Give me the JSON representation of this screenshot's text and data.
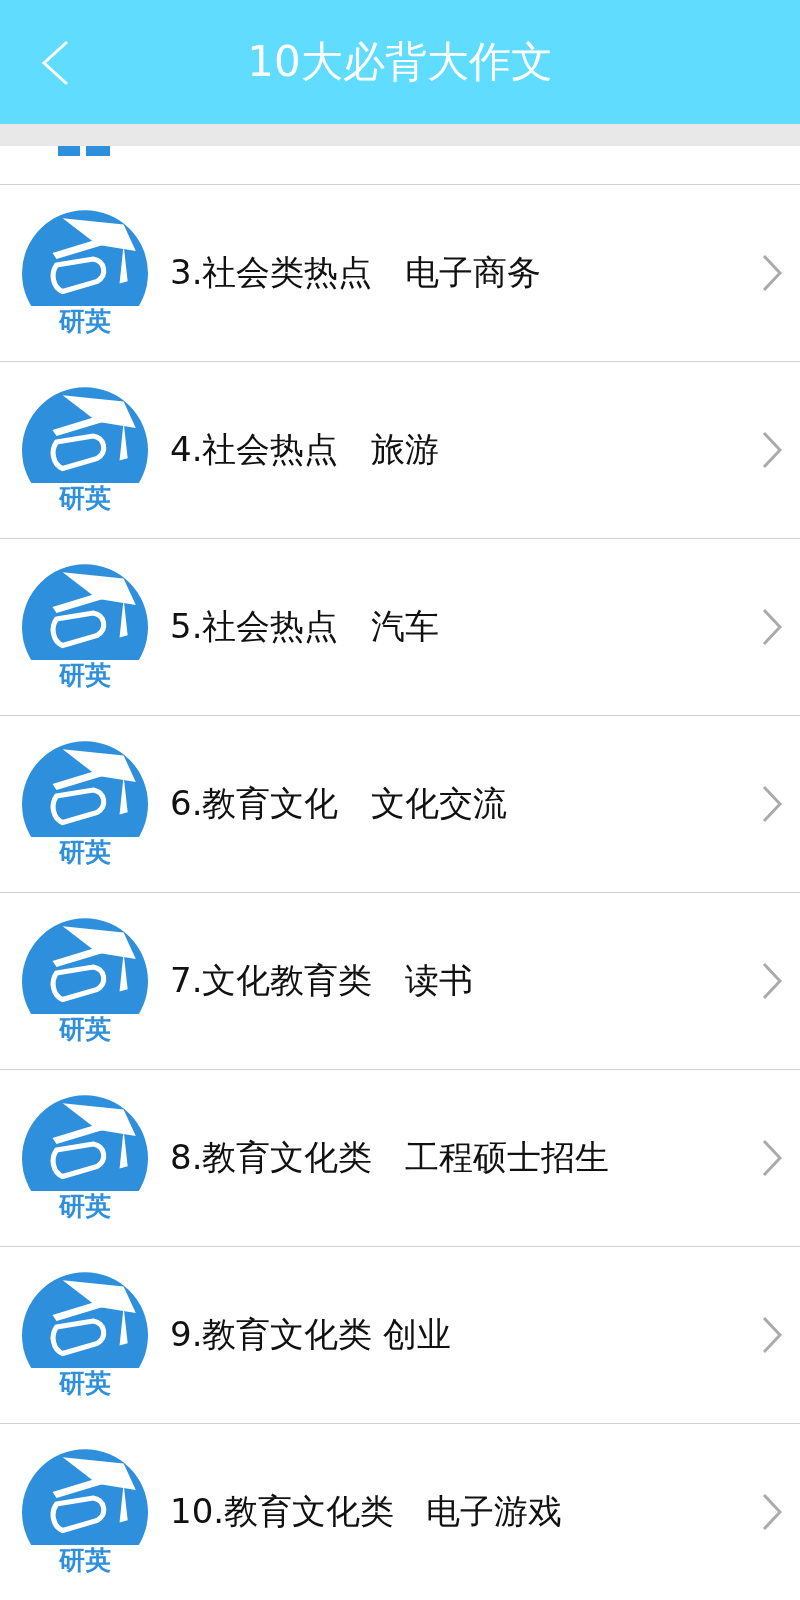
{
  "header": {
    "title": "10大必背大作文"
  },
  "list": {
    "items": [
      {
        "title": "3.社会类热点   电子商务",
        "logo_caption": "研英"
      },
      {
        "title": "4.社会热点   旅游",
        "logo_caption": "研英"
      },
      {
        "title": "5.社会热点   汽车",
        "logo_caption": "研英"
      },
      {
        "title": "6.教育文化   文化交流",
        "logo_caption": "研英"
      },
      {
        "title": "7.文化教育类   读书",
        "logo_caption": "研英"
      },
      {
        "title": "8.教育文化类   工程硕士招生",
        "logo_caption": "研英"
      },
      {
        "title": "9.教育文化类 创业",
        "logo_caption": "研英"
      },
      {
        "title": "10.教育文化类   电子游戏",
        "logo_caption": "研英"
      }
    ]
  }
}
